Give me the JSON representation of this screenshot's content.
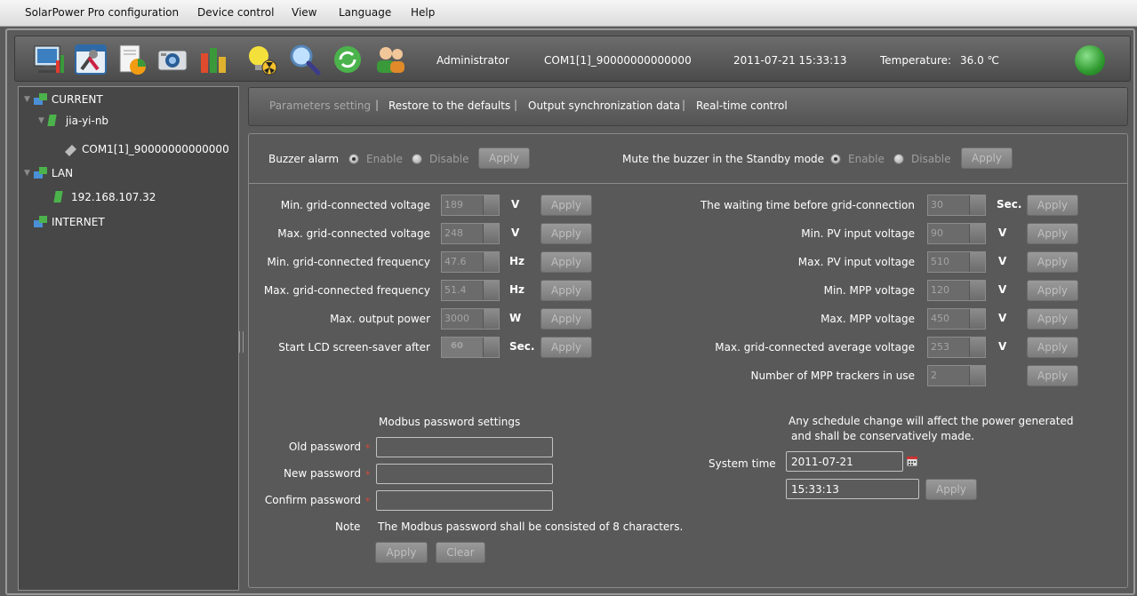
{
  "menu": [
    "SolarPower Pro configuration",
    "Device control",
    "View",
    "Language",
    "Help"
  ],
  "toolbar": {
    "icons": [
      "monitor-icon",
      "settings-tools-icon",
      "report-icon",
      "camera-icon",
      "battery-bar-icon",
      "radiation-bulb-icon",
      "search-icon",
      "refresh-icon",
      "users-icon"
    ],
    "user": "Administrator",
    "port": "COM1[1]_90000000000000",
    "datetime": "2011-07-21 15:33:13",
    "temperature_label": "Temperature:",
    "temperature_value": "36.0 ℃",
    "status_color": "#3da83d"
  },
  "tree": {
    "current": "CURRENT",
    "host": "jia-yi-nb",
    "device": "COM1[1]_90000000000000",
    "lan": "LAN",
    "ip": "192.168.107.32",
    "internet": "INTERNET"
  },
  "tabs": [
    "Parameters setting",
    "Restore to the defaults",
    "Output synchronization data",
    "Real-time control"
  ],
  "buzzer": {
    "label": "Buzzer alarm",
    "enable": "Enable",
    "disable": "Disable",
    "apply": "Apply"
  },
  "mute": {
    "label": "Mute the buzzer in the Standby mode",
    "enable": "Enable",
    "disable": "Disable",
    "apply": "Apply"
  },
  "left_params": [
    {
      "label": "Min. grid-connected voltage",
      "value": "189",
      "unit": "V",
      "apply": "Apply"
    },
    {
      "label": "Max. grid-connected voltage",
      "value": "248",
      "unit": "V",
      "apply": "Apply"
    },
    {
      "label": "Min. grid-connected frequency",
      "value": "47.6",
      "unit": "Hz",
      "apply": "Apply"
    },
    {
      "label": "Max. grid-connected frequency",
      "value": "51.4",
      "unit": "Hz",
      "apply": "Apply"
    },
    {
      "label": "Max. output power",
      "value": "3000",
      "unit": "W",
      "apply": "Apply"
    },
    {
      "label": "Start LCD screen-saver after",
      "value": "60",
      "unit": "Sec.",
      "apply": "Apply"
    }
  ],
  "right_params": [
    {
      "label": "The waiting time before grid-connection",
      "value": "30",
      "unit": "Sec.",
      "apply": "Apply"
    },
    {
      "label": "Min. PV input voltage",
      "value": "90",
      "unit": "V",
      "apply": "Apply"
    },
    {
      "label": "Max. PV input voltage",
      "value": "510",
      "unit": "V",
      "apply": "Apply"
    },
    {
      "label": "Min. MPP voltage",
      "value": "120",
      "unit": "V",
      "apply": "Apply"
    },
    {
      "label": "Max. MPP voltage",
      "value": "450",
      "unit": "V",
      "apply": "Apply"
    },
    {
      "label": "Max. grid-connected average voltage",
      "value": "253",
      "unit": "V",
      "apply": "Apply"
    },
    {
      "label": "Number of MPP trackers in use",
      "value": "2",
      "unit": "",
      "apply": "Apply"
    }
  ],
  "modbus": {
    "title": "Modbus password settings",
    "old": "Old password",
    "new": "New password",
    "confirm": "Confirm password",
    "required_mark": "*",
    "note_label": "Note",
    "note": "The Modbus password shall be consisted of 8 characters.",
    "apply": "Apply",
    "clear": "Clear"
  },
  "system_time": {
    "warning_line1": "Any schedule change will affect the power generated",
    "warning_line2": "and shall be conservatively made.",
    "label": "System time",
    "date": "2011-07-21",
    "time": "15:33:13",
    "apply": "Apply"
  }
}
